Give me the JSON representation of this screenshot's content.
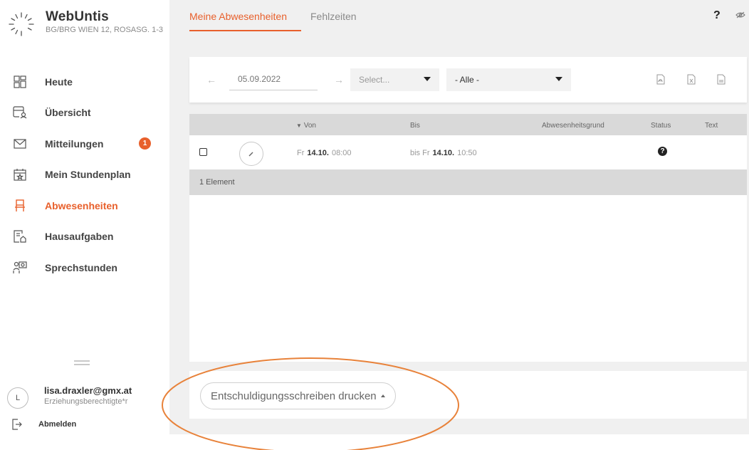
{
  "brand": {
    "title": "WebUntis",
    "school": "BG/BRG WIEN 12, ROSASG. 1-3"
  },
  "nav": {
    "items": [
      {
        "label": "Heute",
        "icon": "dashboard-icon"
      },
      {
        "label": "Übersicht",
        "icon": "overview-icon"
      },
      {
        "label": "Mitteilungen",
        "icon": "mail-icon",
        "badge": "1"
      },
      {
        "label": "Mein Stundenplan",
        "icon": "calendar-icon"
      },
      {
        "label": "Abwesenheiten",
        "icon": "chair-icon",
        "active": true
      },
      {
        "label": "Hausaufgaben",
        "icon": "homework-icon"
      },
      {
        "label": "Sprechstunden",
        "icon": "consultation-icon"
      }
    ]
  },
  "user": {
    "avatar": "L",
    "name": "lisa.draxler@gmx.at",
    "role": "Erziehungsberechtigte*r",
    "logout": "Abmelden"
  },
  "tabs": {
    "active": "Meine Abwesenheiten",
    "other": "Fehlzeiten"
  },
  "header": {
    "help": "?"
  },
  "filter": {
    "date": "05.09.2022",
    "select_placeholder": "Select...",
    "select_all": "- Alle -"
  },
  "table": {
    "headers": {
      "von": "Von",
      "bis": "Bis",
      "grund": "Abwesenheitsgrund",
      "status": "Status",
      "text": "Text"
    },
    "rows": [
      {
        "from_day": "Fr",
        "from_date": "14.10.",
        "from_time": "08:00",
        "to_prefix": "bis Fr",
        "to_date": "14.10.",
        "to_time": "10:50",
        "status": "?"
      }
    ],
    "footer": "1 Element"
  },
  "actions": {
    "print_label": "Entschuldigungsschreiben drucken"
  },
  "colors": {
    "accent": "#e8602c",
    "annotation": "#e8823a"
  }
}
